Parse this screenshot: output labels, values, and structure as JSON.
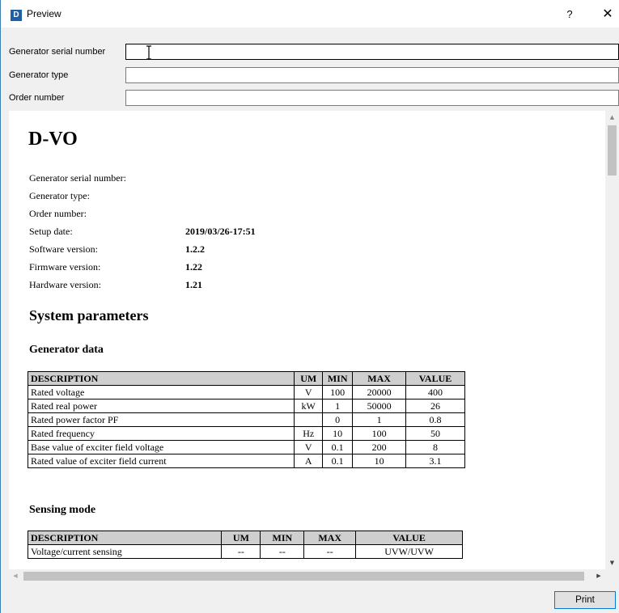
{
  "window": {
    "title": "Preview",
    "app_icon_letter": "D",
    "help_label": "?",
    "close_label": "✕",
    "accent": "#1f5fa8"
  },
  "fields": [
    {
      "label": "Generator serial number",
      "value": ""
    },
    {
      "label": "Generator type",
      "value": ""
    },
    {
      "label": "Order number",
      "value": ""
    }
  ],
  "report": {
    "title": "D-VO",
    "info": [
      {
        "label": "Generator serial number:",
        "value": ""
      },
      {
        "label": "Generator type:",
        "value": ""
      },
      {
        "label": "Order number:",
        "value": ""
      },
      {
        "label": "Setup date:",
        "value": "2019/03/26-17:51"
      },
      {
        "label": "Software version:",
        "value": "1.2.2"
      },
      {
        "label": "Firmware version:",
        "value": "1.22"
      },
      {
        "label": "Hardware version:",
        "value": "1.21"
      }
    ],
    "section_title": "System parameters",
    "generator_data": {
      "title": "Generator data",
      "headers": [
        "DESCRIPTION",
        "UM",
        "MIN",
        "MAX",
        "VALUE"
      ],
      "rows": [
        [
          "Rated voltage",
          "V",
          "100",
          "20000",
          "400"
        ],
        [
          "Rated real power",
          "kW",
          "1",
          "50000",
          "26"
        ],
        [
          "Rated power factor PF",
          "",
          "0",
          "1",
          "0.8"
        ],
        [
          "Rated frequency",
          "Hz",
          "10",
          "100",
          "50"
        ],
        [
          "Base value of exciter field voltage",
          "V",
          "0.1",
          "200",
          "8"
        ],
        [
          "Rated value of exciter field current",
          "A",
          "0.1",
          "10",
          "3.1"
        ]
      ]
    },
    "sensing_mode": {
      "title": "Sensing mode",
      "headers": [
        "DESCRIPTION",
        "UM",
        "MIN",
        "MAX",
        "VALUE"
      ],
      "rows": [
        [
          "Voltage/current sensing",
          "--",
          "--",
          "--",
          "UVW/UVW"
        ]
      ]
    }
  },
  "buttons": {
    "print": "Print"
  }
}
